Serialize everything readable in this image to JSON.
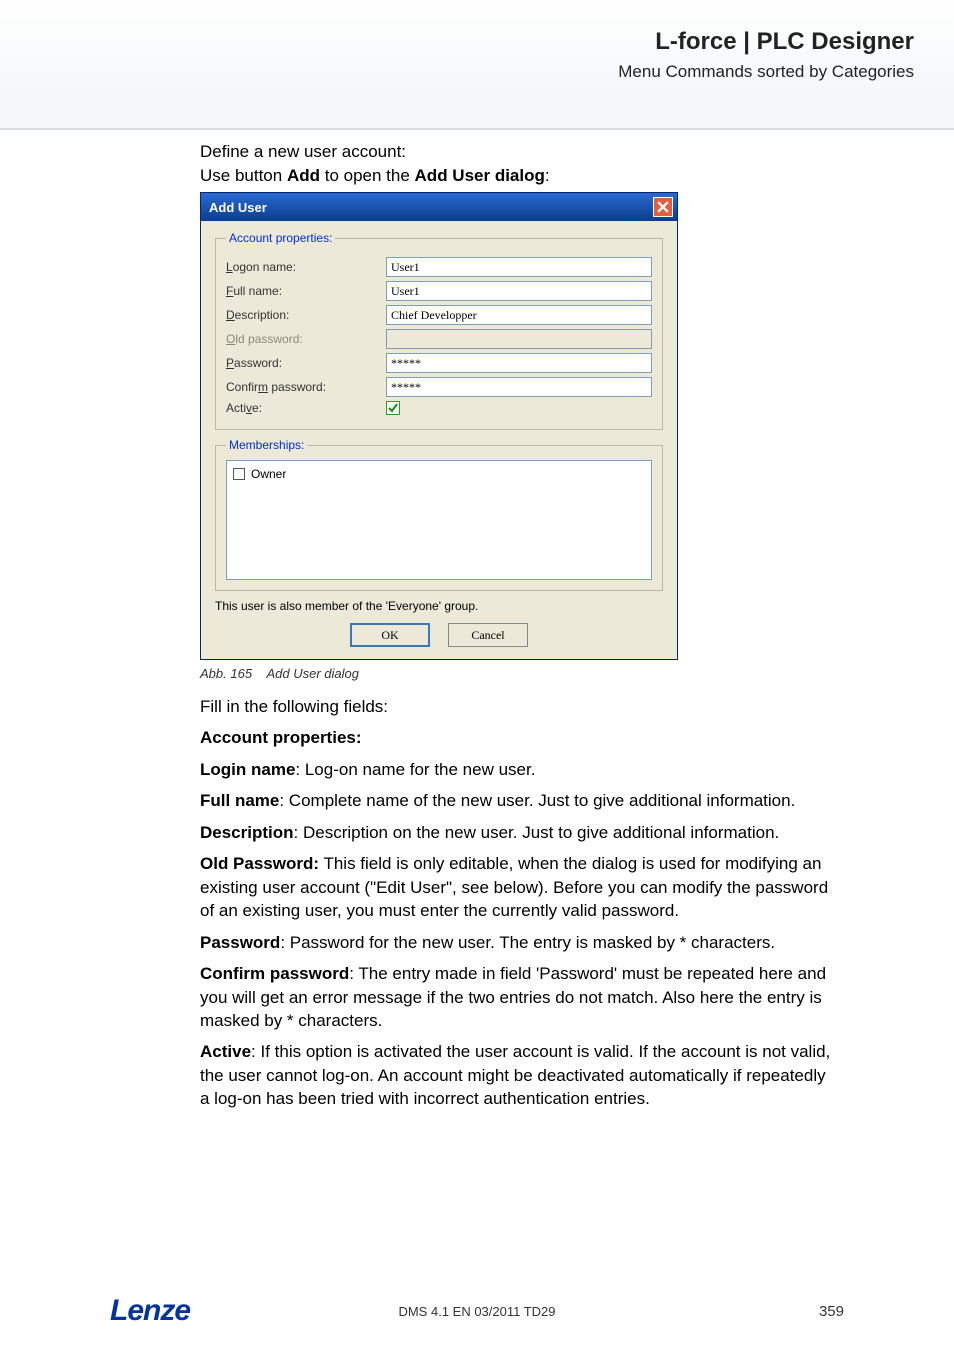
{
  "header": {
    "title": "L-force | PLC Designer",
    "subtitle": "Menu Commands sorted by Categories"
  },
  "intro": {
    "line1": "Define a new user account:",
    "line2_pre": "Use button ",
    "line2_b1": "Add",
    "line2_mid": " to open the ",
    "line2_b2": "Add User dialog",
    "line2_post": ":"
  },
  "dialog": {
    "title": "Add User",
    "group1_legend_u": "A",
    "group1_legend_rest": "ccount properties:",
    "rows": {
      "logon": {
        "u": "L",
        "rest": "ogon name:",
        "value": "User1"
      },
      "full": {
        "u": "F",
        "rest": "ull name:",
        "value": "User1"
      },
      "desc": {
        "u": "D",
        "rest": "escription:",
        "value": "Chief Developper"
      },
      "oldpw": {
        "u": "O",
        "rest": "ld password:",
        "value": ""
      },
      "pw": {
        "u": "P",
        "rest": "assword:",
        "value": "*****"
      },
      "cpw": {
        "pre": "Confir",
        "u": "m",
        "rest": " password:",
        "value": "*****"
      },
      "active": {
        "pre": "Acti",
        "u": "v",
        "rest": "e:",
        "checked": true
      }
    },
    "group2_legend_u": "M",
    "group2_legend_rest": "emberships:",
    "membership_item": "Owner",
    "note": "This user is also member of the 'Everyone' group.",
    "ok": "OK",
    "cancel": "Cancel"
  },
  "caption": {
    "num": "Abb. 165",
    "text": "Add User dialog"
  },
  "prose": {
    "p0": "Fill in the following fields:",
    "p1_b": "Account properties:",
    "p2_b": "Login name",
    "p2": ": Log-on name for the new user.",
    "p3_b": "Full name",
    "p3": ": Complete name of the new user. Just to give additional information.",
    "p4_b": "Description",
    "p4": ": Description on the new user. Just to give additional information.",
    "p5_b": "Old Password:",
    "p5": " This field is only editable, when the dialog is used for modifying an existing user account (\"Edit User\", see below). Before you can modify the password of an existing user, you must enter the currently valid password.",
    "p6_b": "Password",
    "p6": ": Password for the new user. The entry is masked by * characters.",
    "p7_b": "Confirm password",
    "p7": ": The entry made in field 'Password' must be repeated here and you will get an error message if the two entries do not match. Also here the entry is masked by * characters.",
    "p8_b": "Active",
    "p8": ": If this option is activated the user account is valid. If the account is not valid, the user cannot log-on. An account might be deactivated automatically if repeatedly a log-on has been tried with incorrect authentication entries."
  },
  "footer": {
    "logo": "Lenze",
    "docid": "DMS 4.1 EN 03/2011 TD29",
    "page": "359"
  }
}
